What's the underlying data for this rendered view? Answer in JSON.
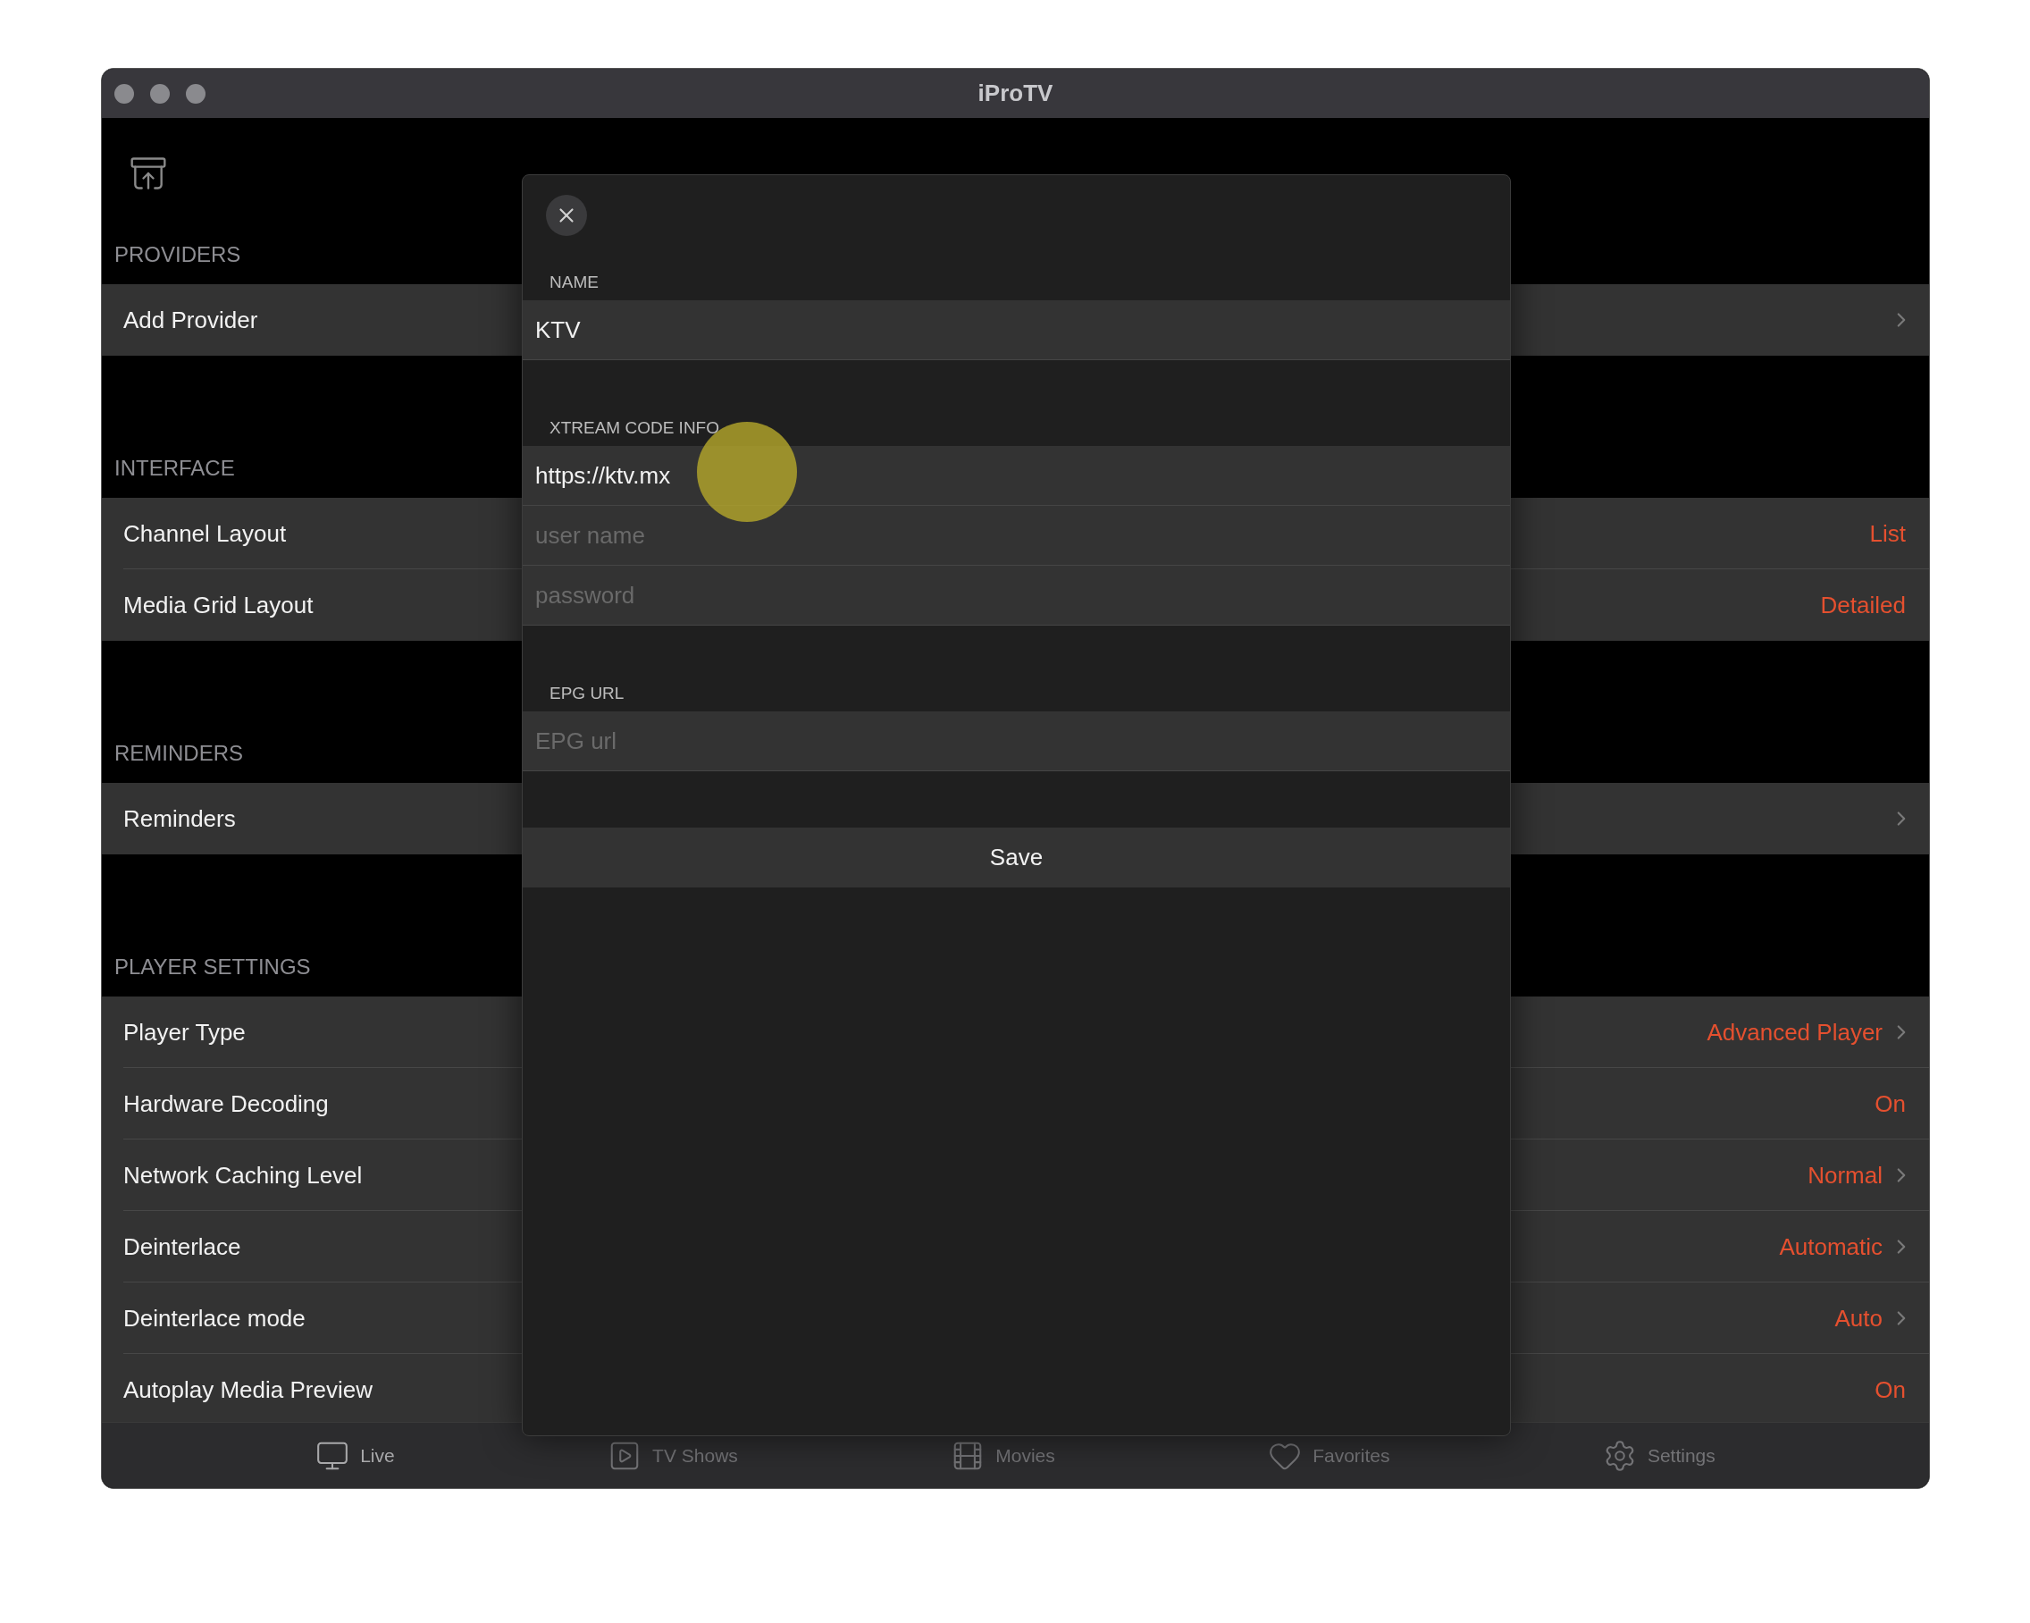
{
  "window": {
    "title": "iProTV"
  },
  "sections": [
    {
      "header": "PROVIDERS",
      "rows": [
        {
          "label": "Add Provider",
          "chevron": true
        }
      ]
    },
    {
      "header": "INTERFACE",
      "rows": [
        {
          "label": "Channel Layout",
          "value": "List",
          "chevron": false
        },
        {
          "label": "Media Grid Layout",
          "value": "Detailed",
          "chevron": false
        }
      ]
    },
    {
      "header": "REMINDERS",
      "rows": [
        {
          "label": "Reminders",
          "chevron": true
        }
      ]
    },
    {
      "header": "PLAYER SETTINGS",
      "rows": [
        {
          "label": "Player Type",
          "value": "Advanced Player",
          "chevron": true
        },
        {
          "label": "Hardware Decoding",
          "value": "On",
          "chevron": false
        },
        {
          "label": "Network Caching Level",
          "value": "Normal",
          "chevron": true
        },
        {
          "label": "Deinterlace",
          "value": "Automatic",
          "chevron": true
        },
        {
          "label": "Deinterlace mode",
          "value": "Auto",
          "chevron": true
        },
        {
          "label": "Autoplay Media Preview",
          "value": "On",
          "chevron": false
        }
      ]
    }
  ],
  "modal": {
    "groups": [
      {
        "label": "NAME",
        "fields": [
          {
            "value": "KTV"
          }
        ]
      },
      {
        "label": "XTREAM CODE INFO",
        "fields": [
          {
            "value": "https://ktv.mx"
          },
          {
            "placeholder": "user name"
          },
          {
            "placeholder": "password"
          }
        ]
      },
      {
        "label": "EPG URL",
        "fields": [
          {
            "placeholder": "EPG url"
          }
        ]
      }
    ],
    "save": "Save"
  },
  "tab_bar": [
    {
      "label": "Live",
      "selected": true
    },
    {
      "label": "TV Shows",
      "selected": false
    },
    {
      "label": "Movies",
      "selected": false
    },
    {
      "label": "Favorites",
      "selected": false
    },
    {
      "label": "Settings",
      "selected": false
    }
  ]
}
